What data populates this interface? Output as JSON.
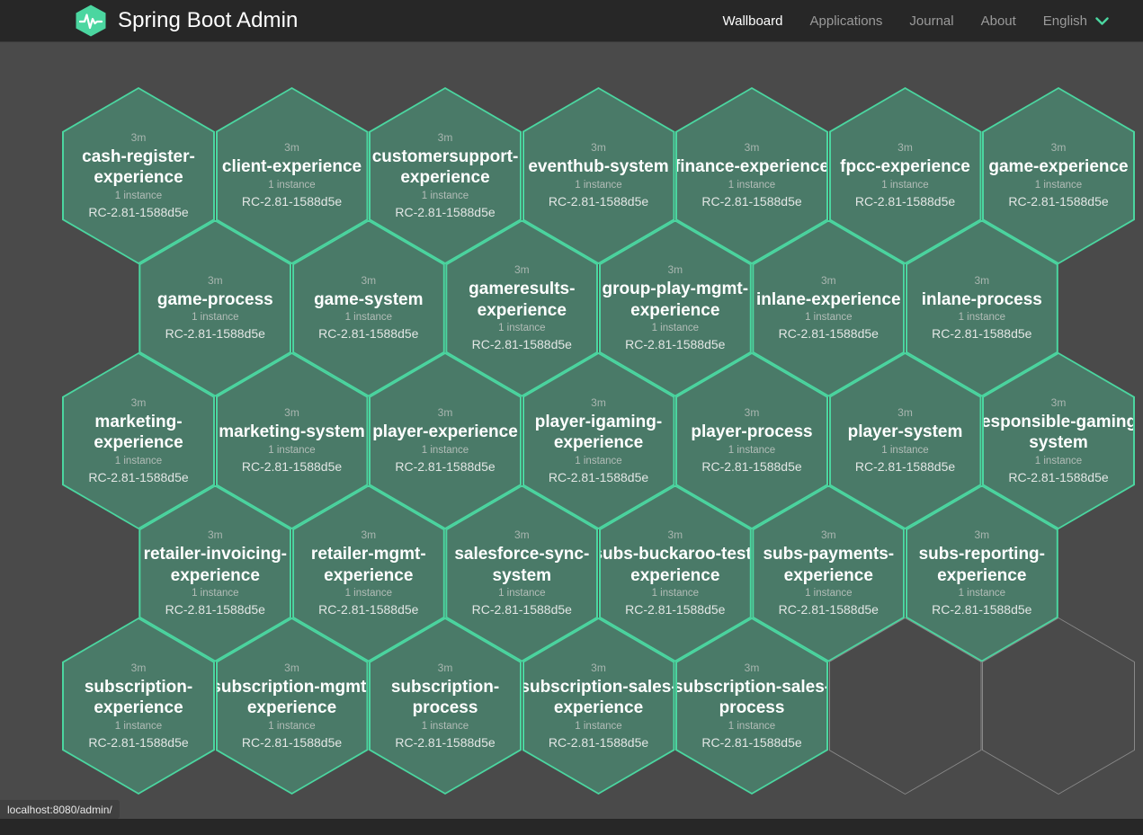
{
  "app": {
    "title": "Spring Boot Admin",
    "logo_icon": "heartbeat-hexagon-icon",
    "accent_color": "#4bd6a0",
    "background_color": "#4a4a4a",
    "navbar_color": "#272727",
    "hex_fill_color": "#4a7a68",
    "hex_border_color": "#4bd6a0"
  },
  "nav": {
    "items": [
      {
        "label": "Wallboard",
        "active": true
      },
      {
        "label": "Applications",
        "active": false
      },
      {
        "label": "Journal",
        "active": false
      },
      {
        "label": "About",
        "active": false
      }
    ],
    "language": {
      "label": "English",
      "icon": "chevron-down-icon"
    }
  },
  "statusbar": {
    "url": "localhost:8080/admin/"
  },
  "wallboard": {
    "labels": {
      "instances_suffix": "instance"
    },
    "applications": [
      {
        "name": "cash-register-experience",
        "uptime": "3m",
        "instances": "1 instance",
        "version": "RC-2.81-1588d5e",
        "col": 0,
        "row": 0
      },
      {
        "name": "client-experience",
        "uptime": "3m",
        "instances": "1 instance",
        "version": "RC-2.81-1588d5e",
        "col": 1,
        "row": 0
      },
      {
        "name": "customersupport-experience",
        "uptime": "3m",
        "instances": "1 instance",
        "version": "RC-2.81-1588d5e",
        "col": 2,
        "row": 0
      },
      {
        "name": "eventhub-system",
        "uptime": "3m",
        "instances": "1 instance",
        "version": "RC-2.81-1588d5e",
        "col": 3,
        "row": 0
      },
      {
        "name": "finance-experience",
        "uptime": "3m",
        "instances": "1 instance",
        "version": "RC-2.81-1588d5e",
        "col": 4,
        "row": 0
      },
      {
        "name": "fpcc-experience",
        "uptime": "3m",
        "instances": "1 instance",
        "version": "RC-2.81-1588d5e",
        "col": 5,
        "row": 0
      },
      {
        "name": "game-experience",
        "uptime": "3m",
        "instances": "1 instance",
        "version": "RC-2.81-1588d5e",
        "col": 6,
        "row": 0
      },
      {
        "name": "game-process",
        "uptime": "3m",
        "instances": "1 instance",
        "version": "RC-2.81-1588d5e",
        "col": 0,
        "row": 1
      },
      {
        "name": "game-system",
        "uptime": "3m",
        "instances": "1 instance",
        "version": "RC-2.81-1588d5e",
        "col": 1,
        "row": 1
      },
      {
        "name": "gameresults-experience",
        "uptime": "3m",
        "instances": "1 instance",
        "version": "RC-2.81-1588d5e",
        "col": 2,
        "row": 1
      },
      {
        "name": "group-play-mgmt-experience",
        "uptime": "3m",
        "instances": "1 instance",
        "version": "RC-2.81-1588d5e",
        "col": 3,
        "row": 1
      },
      {
        "name": "inlane-experience",
        "uptime": "3m",
        "instances": "1 instance",
        "version": "RC-2.81-1588d5e",
        "col": 4,
        "row": 1
      },
      {
        "name": "inlane-process",
        "uptime": "3m",
        "instances": "1 instance",
        "version": "RC-2.81-1588d5e",
        "col": 5,
        "row": 1
      },
      {
        "name": "marketing-experience",
        "uptime": "3m",
        "instances": "1 instance",
        "version": "RC-2.81-1588d5e",
        "col": 0,
        "row": 2
      },
      {
        "name": "marketing-system",
        "uptime": "3m",
        "instances": "1 instance",
        "version": "RC-2.81-1588d5e",
        "col": 1,
        "row": 2
      },
      {
        "name": "player-experience",
        "uptime": "3m",
        "instances": "1 instance",
        "version": "RC-2.81-1588d5e",
        "col": 2,
        "row": 2
      },
      {
        "name": "player-igaming-experience",
        "uptime": "3m",
        "instances": "1 instance",
        "version": "RC-2.81-1588d5e",
        "col": 3,
        "row": 2
      },
      {
        "name": "player-process",
        "uptime": "3m",
        "instances": "1 instance",
        "version": "RC-2.81-1588d5e",
        "col": 4,
        "row": 2
      },
      {
        "name": "player-system",
        "uptime": "3m",
        "instances": "1 instance",
        "version": "RC-2.81-1588d5e",
        "col": 5,
        "row": 2
      },
      {
        "name": "responsible-gaming-system",
        "uptime": "3m",
        "instances": "1 instance",
        "version": "RC-2.81-1588d5e",
        "col": 6,
        "row": 2
      },
      {
        "name": "retailer-invoicing-experience",
        "uptime": "3m",
        "instances": "1 instance",
        "version": "RC-2.81-1588d5e",
        "col": 0,
        "row": 3
      },
      {
        "name": "retailer-mgmt-experience",
        "uptime": "3m",
        "instances": "1 instance",
        "version": "RC-2.81-1588d5e",
        "col": 1,
        "row": 3
      },
      {
        "name": "salesforce-sync-system",
        "uptime": "3m",
        "instances": "1 instance",
        "version": "RC-2.81-1588d5e",
        "col": 2,
        "row": 3
      },
      {
        "name": "subs-buckaroo-test-experience",
        "uptime": "3m",
        "instances": "1 instance",
        "version": "RC-2.81-1588d5e",
        "col": 3,
        "row": 3
      },
      {
        "name": "subs-payments-experience",
        "uptime": "3m",
        "instances": "1 instance",
        "version": "RC-2.81-1588d5e",
        "col": 4,
        "row": 3
      },
      {
        "name": "subs-reporting-experience",
        "uptime": "3m",
        "instances": "1 instance",
        "version": "RC-2.81-1588d5e",
        "col": 5,
        "row": 3
      },
      {
        "name": "subscription-experience",
        "uptime": "3m",
        "instances": "1 instance",
        "version": "RC-2.81-1588d5e",
        "col": 0,
        "row": 4
      },
      {
        "name": "subscription-mgmt-experience",
        "uptime": "3m",
        "instances": "1 instance",
        "version": "RC-2.81-1588d5e",
        "col": 1,
        "row": 4
      },
      {
        "name": "subscription-process",
        "uptime": "3m",
        "instances": "1 instance",
        "version": "RC-2.81-1588d5e",
        "col": 2,
        "row": 4
      },
      {
        "name": "subscription-sales-experience",
        "uptime": "3m",
        "instances": "1 instance",
        "version": "RC-2.81-1588d5e",
        "col": 3,
        "row": 4
      },
      {
        "name": "subscription-sales-process",
        "uptime": "3m",
        "instances": "1 instance",
        "version": "RC-2.81-1588d5e",
        "col": 4,
        "row": 4
      }
    ],
    "empty_slots": [
      {
        "col": 5,
        "row": 4
      },
      {
        "col": 6,
        "row": 4
      }
    ]
  }
}
